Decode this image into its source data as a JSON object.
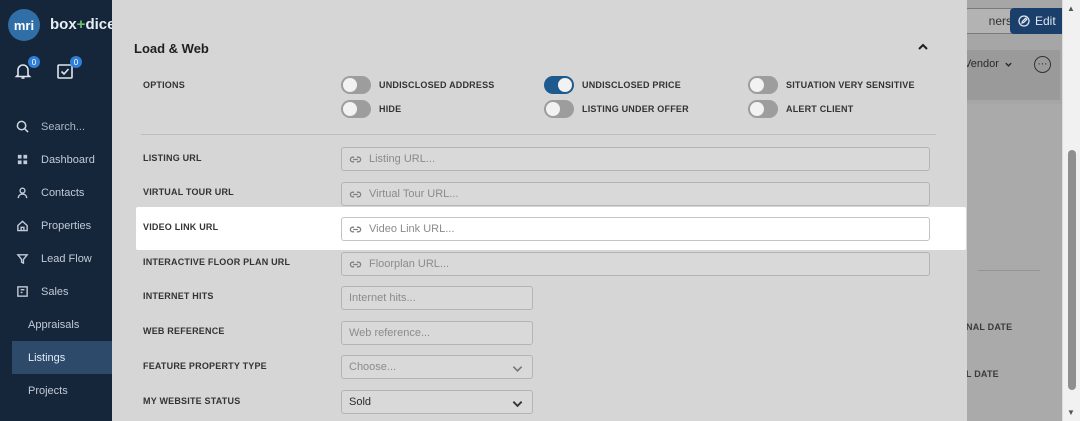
{
  "app": {
    "logo_initials": "mri",
    "brand_left": "box",
    "brand_plus": "+",
    "brand_right": "dice",
    "notification_count": "0",
    "task_count": "0"
  },
  "sidebar": {
    "search_label": "Search...",
    "items": [
      {
        "label": "Dashboard",
        "icon": "grid-icon"
      },
      {
        "label": "Contacts",
        "icon": "user-icon"
      },
      {
        "label": "Properties",
        "icon": "home-icon"
      },
      {
        "label": "Lead Flow",
        "icon": "funnel-icon"
      },
      {
        "label": "Sales",
        "icon": "sales-icon"
      }
    ],
    "sub_items": [
      "Appraisals",
      "Listings",
      "Projects"
    ],
    "active_sub_item": "Listings"
  },
  "header": {
    "owners_label": "ners",
    "edit_label": "Edit",
    "vendor_label": "Vendor"
  },
  "background_card": {
    "labels": [
      "NAL DATE",
      "L DATE"
    ]
  },
  "modal": {
    "section_title": "Load & Web",
    "options_label": "OPTIONS",
    "options": [
      {
        "label": "UNDISCLOSED ADDRESS",
        "on": false
      },
      {
        "label": "UNDISCLOSED PRICE",
        "on": true
      },
      {
        "label": "SITUATION VERY SENSITIVE",
        "on": false
      },
      {
        "label": "HIDE",
        "on": false
      },
      {
        "label": "LISTING UNDER OFFER",
        "on": false
      },
      {
        "label": "ALERT CLIENT",
        "on": false
      }
    ],
    "fields": {
      "listing_url": {
        "label": "LISTING URL",
        "placeholder": "Listing URL..."
      },
      "virtual_tour_url": {
        "label": "VIRTUAL TOUR URL",
        "placeholder": "Virtual Tour URL..."
      },
      "video_link_url": {
        "label": "VIDEO LINK URL",
        "placeholder": "Video Link URL..."
      },
      "interactive_floor_plan_url": {
        "label": "INTERACTIVE FLOOR PLAN URL",
        "placeholder": "Floorplan URL..."
      },
      "internet_hits": {
        "label": "INTERNET HITS",
        "placeholder": "Internet hits..."
      },
      "web_reference": {
        "label": "WEB REFERENCE",
        "placeholder": "Web reference..."
      },
      "feature_property_type": {
        "label": "FEATURE PROPERTY TYPE",
        "placeholder": "Choose..."
      },
      "my_website_status": {
        "label": "MY WEBSITE STATUS",
        "value": "Sold"
      }
    }
  },
  "colors": {
    "sidebar_bg": "#15253a",
    "toggle_on": "#1e5a8e",
    "edit_button": "#1b3f6b",
    "highlight": "#ffffff"
  }
}
